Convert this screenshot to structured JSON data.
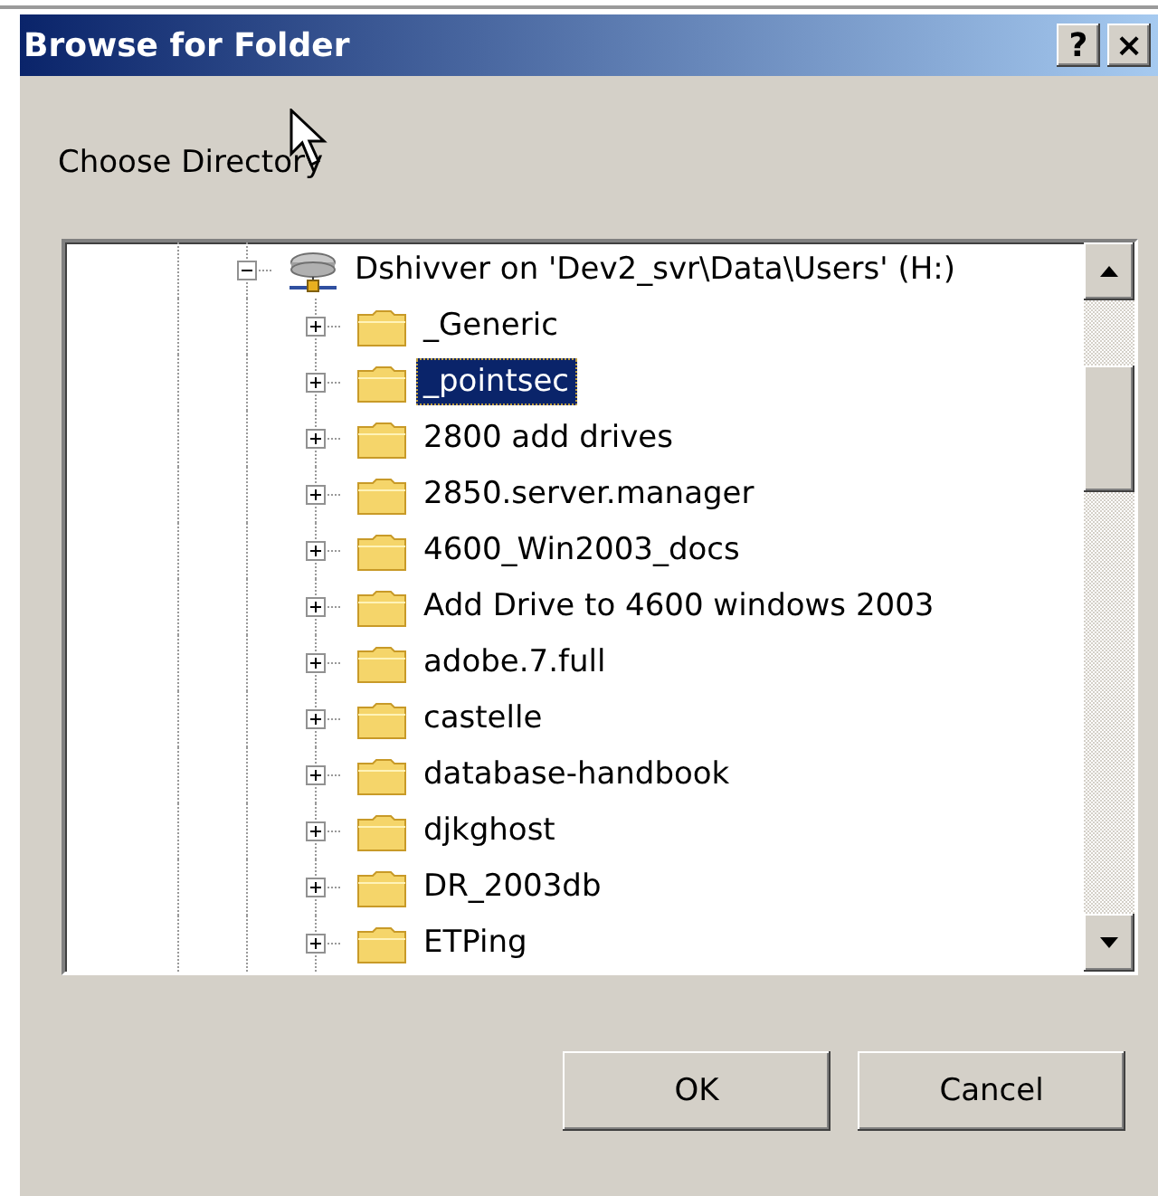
{
  "window": {
    "title": "Browse for Folder",
    "title_buttons": [
      "?",
      "×"
    ]
  },
  "prompt": "Choose Directory",
  "tree": {
    "items": [
      {
        "label": "Dshivver on 'Dev2_svr\\Data\\Users' (H:)",
        "kind": "drive",
        "expanded": true,
        "selected": false,
        "children": [
          {
            "label": "_Generic",
            "kind": "folder",
            "expanded": false,
            "selected": false
          },
          {
            "label": "_pointsec",
            "kind": "folder",
            "expanded": false,
            "selected": true
          },
          {
            "label": "2800 add drives",
            "kind": "folder",
            "expanded": false,
            "selected": false
          },
          {
            "label": "2850.server.manager",
            "kind": "folder",
            "expanded": false,
            "selected": false
          },
          {
            "label": "4600_Win2003_docs",
            "kind": "folder",
            "expanded": false,
            "selected": false
          },
          {
            "label": "Add Drive to 4600 windows 2003",
            "kind": "folder",
            "expanded": false,
            "selected": false
          },
          {
            "label": "adobe.7.full",
            "kind": "folder",
            "expanded": false,
            "selected": false
          },
          {
            "label": "castelle",
            "kind": "folder",
            "expanded": false,
            "selected": false
          },
          {
            "label": "database-handbook",
            "kind": "folder",
            "expanded": false,
            "selected": false
          },
          {
            "label": "djkghost",
            "kind": "folder",
            "expanded": false,
            "selected": false
          },
          {
            "label": "DR_2003db",
            "kind": "folder",
            "expanded": false,
            "selected": false
          },
          {
            "label": "ETPing",
            "kind": "folder",
            "expanded": false,
            "selected": false
          }
        ]
      }
    ]
  },
  "buttons": [
    "OK",
    "Cancel"
  ]
}
